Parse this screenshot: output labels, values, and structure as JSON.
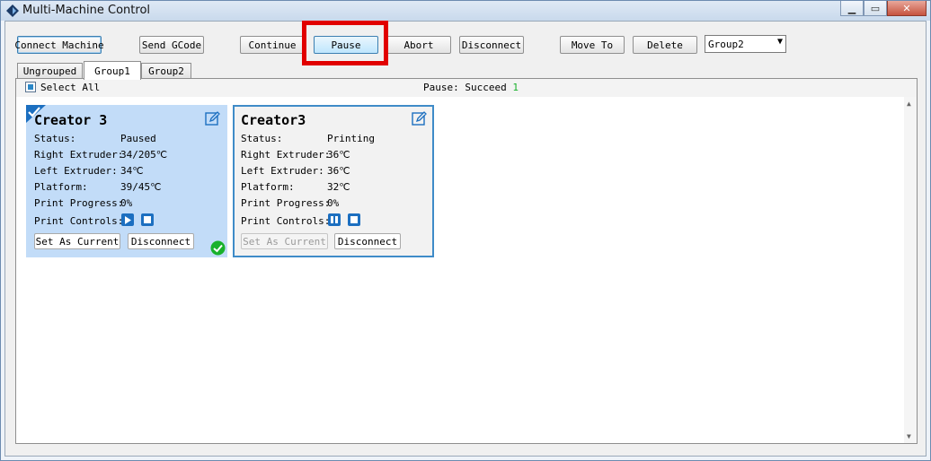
{
  "window": {
    "title": "Multi-Machine Control"
  },
  "toolbar": {
    "connect_machine": "Connect Machine",
    "send_gcode": "Send GCode",
    "continue": "Continue",
    "pause": "Pause",
    "abort": "Abort",
    "disconnect": "Disconnect",
    "move_to": "Move To",
    "delete": "Delete",
    "group_select": "Group2"
  },
  "tabs": [
    "Ungrouped",
    "Group1",
    "Group2"
  ],
  "active_tab": "Group1",
  "select_all_label": "Select All",
  "status": {
    "label": "Pause: Succeed",
    "count": "1"
  },
  "field_labels": {
    "status": "Status:",
    "right_extruder": "Right Extruder:",
    "left_extruder": "Left Extruder:",
    "platform": "Platform:",
    "print_progress": "Print Progress:",
    "print_controls": "Print Controls:"
  },
  "machines": [
    {
      "name": "Creator 3",
      "status": "Paused",
      "right_extruder": "34/205℃",
      "left_extruder": "34℃",
      "platform": "39/45℃",
      "print_progress": "0%",
      "set_current": "Set As Current",
      "disconnect": "Disconnect"
    },
    {
      "name": "Creator3",
      "status": "Printing",
      "right_extruder": "36℃",
      "left_extruder": "36℃",
      "platform": "32℃",
      "print_progress": "0%",
      "set_current": "Set As Current",
      "disconnect": "Disconnect"
    }
  ],
  "colors": {
    "accent": "#1c6fc0",
    "highlight": "#e10000",
    "success": "#19b12c",
    "card_selected": "#c2dcf8"
  }
}
